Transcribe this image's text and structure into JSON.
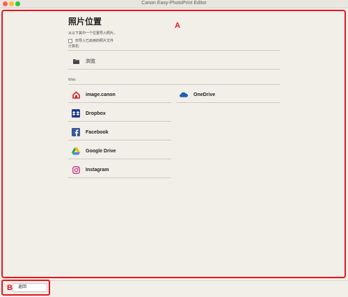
{
  "window": {
    "title": "Canon Easy-PhotoPrint Editor"
  },
  "callouts": {
    "a": "A",
    "b": "B"
  },
  "header": {
    "title": "照片位置",
    "subtitle": "从以下其中一个位置导入照片。",
    "checkbox_label": "仅导入已启用的照片文件"
  },
  "computer_section": {
    "label": "计算机:",
    "browse_label": "浏览"
  },
  "web_section": {
    "label": "Web:",
    "left_items": [
      {
        "label": "image.canon",
        "icon": "image-canon-icon"
      },
      {
        "label": "Dropbox",
        "icon": "dropbox-icon"
      },
      {
        "label": "Facebook",
        "icon": "facebook-icon"
      },
      {
        "label": "Google Drive",
        "icon": "google-drive-icon"
      },
      {
        "label": "Instagram",
        "icon": "instagram-icon"
      }
    ],
    "right_items": [
      {
        "label": "OneDrive",
        "icon": "onedrive-icon"
      }
    ]
  },
  "footer": {
    "back_label": "返回"
  },
  "colors": {
    "callout": "#e0161e",
    "background": "#f2eee8"
  }
}
